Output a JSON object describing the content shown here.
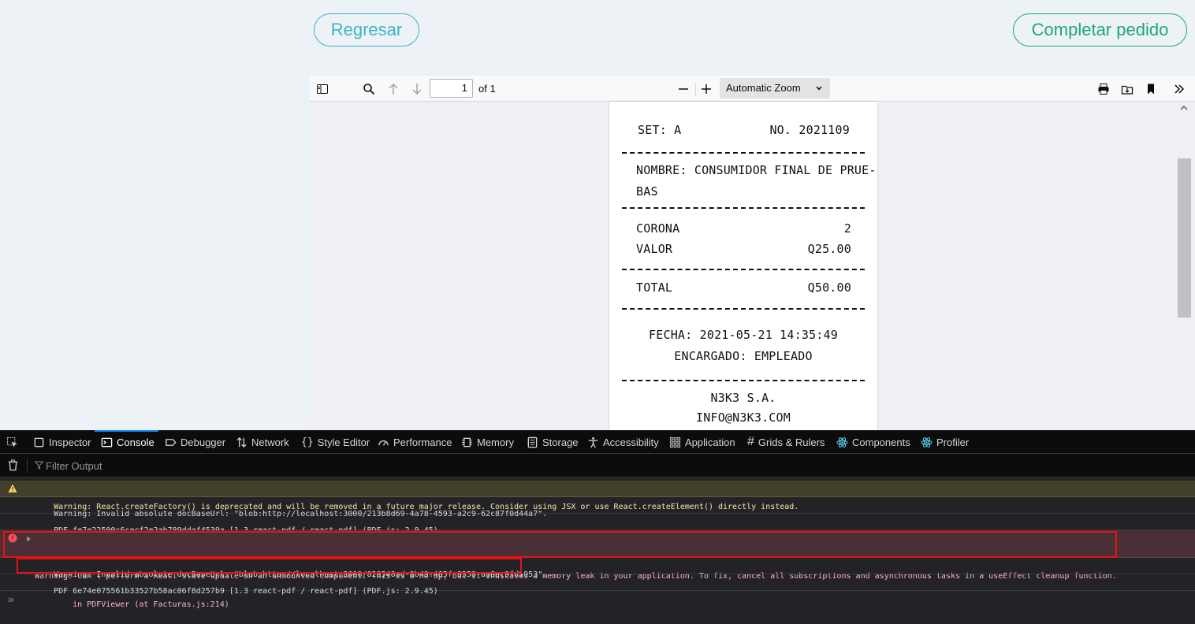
{
  "page": {
    "back_button": "Regresar",
    "complete_button": "Completar pedido"
  },
  "viewer": {
    "page_number": "1",
    "page_total": "of 1",
    "zoom": "Automatic Zoom"
  },
  "receipt": {
    "set": "SET: A",
    "number": "NO. 2021109",
    "name_line1": "NOMBRE: CONSUMIDOR FINAL DE PRUE-",
    "name_line2": "BAS",
    "item_name": "CORONA",
    "item_qty": "2",
    "value_label": "VALOR",
    "value_amount": "Q25.00",
    "total_label": "TOTAL",
    "total_amount": "Q50.00",
    "date": "FECHA: 2021-05-21 14:35:49",
    "attendant": "ENCARGADO: EMPLEADO",
    "company": "N3K3 S.A.",
    "email": "INFO@N3K3.COM"
  },
  "devtools": {
    "tabs": [
      "Inspector",
      "Console",
      "Debugger",
      "Network",
      "Style Editor",
      "Performance",
      "Memory",
      "Storage",
      "Accessibility",
      "Application",
      "Grids & Rulers",
      "Components",
      "Profiler"
    ],
    "active_tab": "Console",
    "filter_placeholder": "Filter Output",
    "messages": [
      {
        "level": "warning",
        "text": "Warning: React.createFactory() is deprecated and will be removed in a future major release. Consider using JSX or use React.createElement() directly instead."
      },
      {
        "level": "log",
        "text": "Warning: Invalid absolute docBaseUrl: \"blob:http://localhost:3000/213b8d69-4a78-4593-a2c9-62c87f0d44a7\"."
      },
      {
        "level": "log",
        "text": "PDF fe7e22500c6cecf2e2ab789ddaf4539a [1.3 react-pdf / react-pdf] (PDF.js: 2.9.45)"
      },
      {
        "level": "error",
        "text": "Warning: Can't perform a React state update on an unmounted component. This is a no-op, but it indicates a memory leak in your application. To fix, cancel all subscriptions and asynchronous tasks in a useEffect cleanup function.",
        "text2": "    in PDFViewer (at Facturas.js:214)"
      },
      {
        "level": "log",
        "text": "Warning: Invalid absolute docBaseUrl: \"blob:http://localhost:3000/828548ad-8b49-465f-9358-aa6ec9fd1953\"."
      },
      {
        "level": "log",
        "text": "PDF 6e74e075561b33527b58ac06f8d257b9 [1.3 react-pdf / react-pdf] (PDF.js: 2.9.45)"
      }
    ],
    "prompt_symbol": "»"
  },
  "colors": {
    "back_button": "#39b6c6",
    "complete_button": "#1fa57e",
    "devtools_bg": "#232327",
    "warning_bg": "#423f2a",
    "error_bg": "#4b2f36",
    "highlight_box": "#e41414"
  }
}
